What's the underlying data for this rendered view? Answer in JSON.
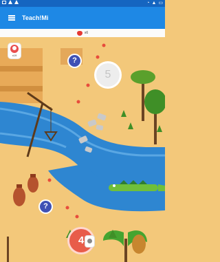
{
  "app": {
    "title": "Teach!Mi"
  },
  "lives": {
    "count": "x6"
  },
  "user": {
    "level": "x19"
  },
  "nodes": {
    "locked_number": "5",
    "current_number": "4"
  },
  "question_mark": "?"
}
